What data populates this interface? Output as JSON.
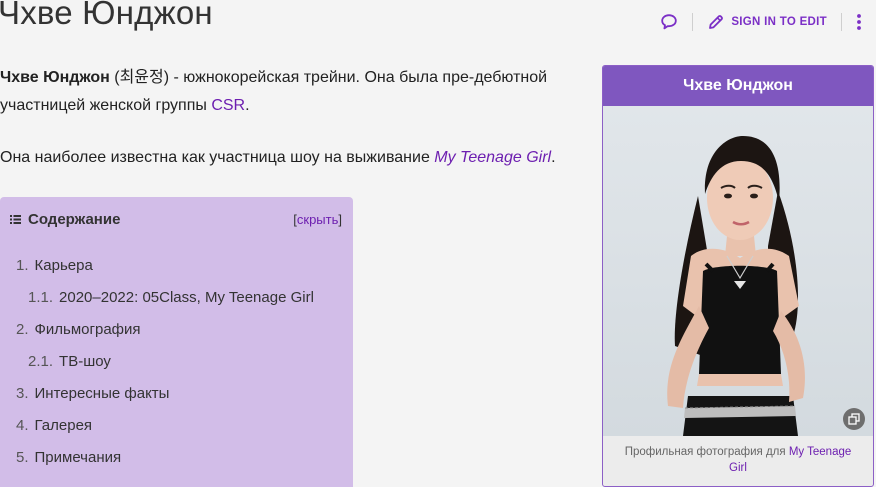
{
  "page": {
    "title": "Чхве Юнджон"
  },
  "actions": {
    "sign_in_label": "SIGN IN TO EDIT"
  },
  "intro": {
    "name_bold": "Чхве Юнджон",
    "name_korean": " (최윤정) - южнокорейская трейни. Она была пре-дебютной участницей женской группы ",
    "group_link": "CSR",
    "end": "."
  },
  "para2": {
    "text": "Она наиболее известна как участница шоу на выживание ",
    "show_link": "My Teenage Girl",
    "end": "."
  },
  "toc": {
    "title": "Содержание",
    "toggle_open": "[",
    "toggle_link": "скрыть",
    "toggle_close": "]",
    "items": [
      {
        "num": "1.",
        "label": "Карьера"
      },
      {
        "num": "1.1.",
        "label": "2020–2022: 05Class, My Teenage Girl"
      },
      {
        "num": "2.",
        "label": "Фильмография"
      },
      {
        "num": "2.1.",
        "label": "ТВ-шоу"
      },
      {
        "num": "3.",
        "label": "Интересные факты"
      },
      {
        "num": "4.",
        "label": "Галерея"
      },
      {
        "num": "5.",
        "label": "Примечания"
      }
    ]
  },
  "infobox": {
    "title": "Чхве Юнджон",
    "caption_text": "Профильная фотография для ",
    "caption_link": "My Teenage",
    "caption_link_2": "Girl"
  },
  "colors": {
    "accent": "#7b2fc6",
    "toc_bg": "#d2bde8",
    "infobox_header": "#7f57bf"
  }
}
